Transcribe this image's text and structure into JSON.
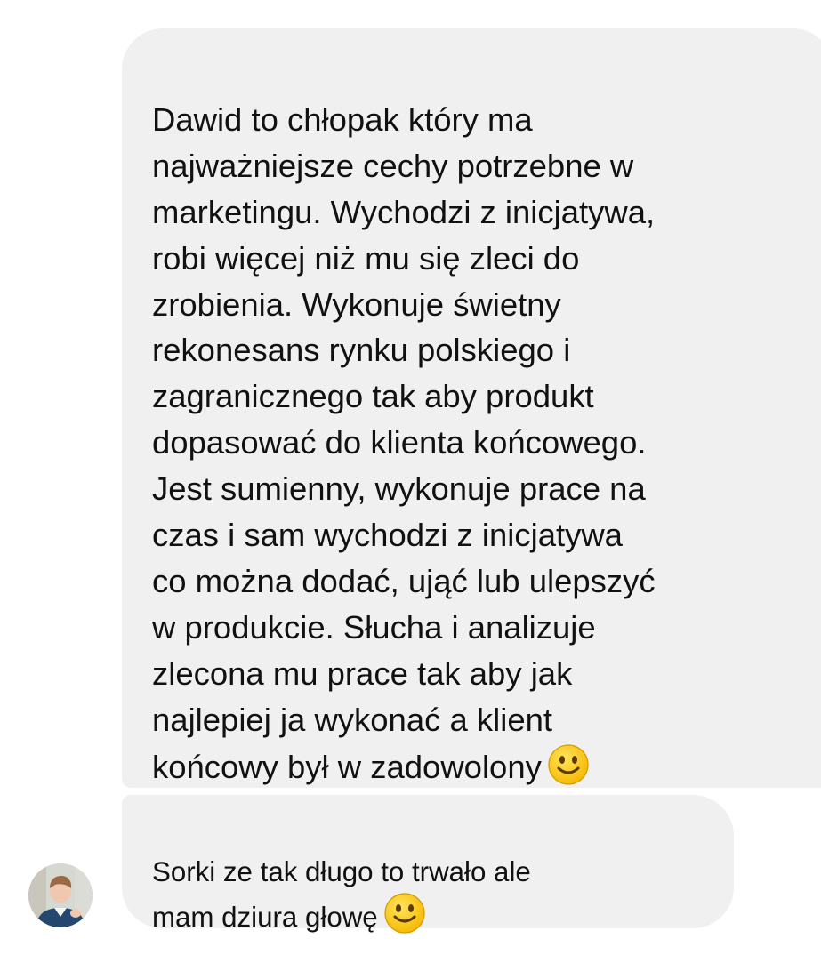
{
  "messages": [
    {
      "text": "Dawid to chłopak który ma\nnajważniejsze cechy potrzebne w\nmarketingu. Wychodzi z inicjatywa,\nrobi więcej niż mu się zleci do\nzrobienia. Wykonuje świetny\nrekonesans rynku polskiego i\nzagranicznego tak aby produkt\ndopasować do klienta końcowego.\nJest sumienny, wykonuje prace na\nczas i sam wychodzi z inicjatywa\nco można dodać, ująć lub ulepszyć\nw produkcie. Słucha i analizuje\nzlecona mu prace tak aby jak\nnajlepiej ja wykonać a klient\nkońcowy był w zadowolony",
      "emoji": "slightly-smiling-face-icon"
    },
    {
      "text": "Sorki ze tak długo to trwało ale\nmam dziura głowę",
      "emoji": "slightly-smiling-face-icon"
    }
  ],
  "colors": {
    "bubble_background": "#f0f0f0",
    "text": "#111111",
    "page_background": "#ffffff"
  },
  "avatar": {
    "icon": "sender-avatar"
  }
}
